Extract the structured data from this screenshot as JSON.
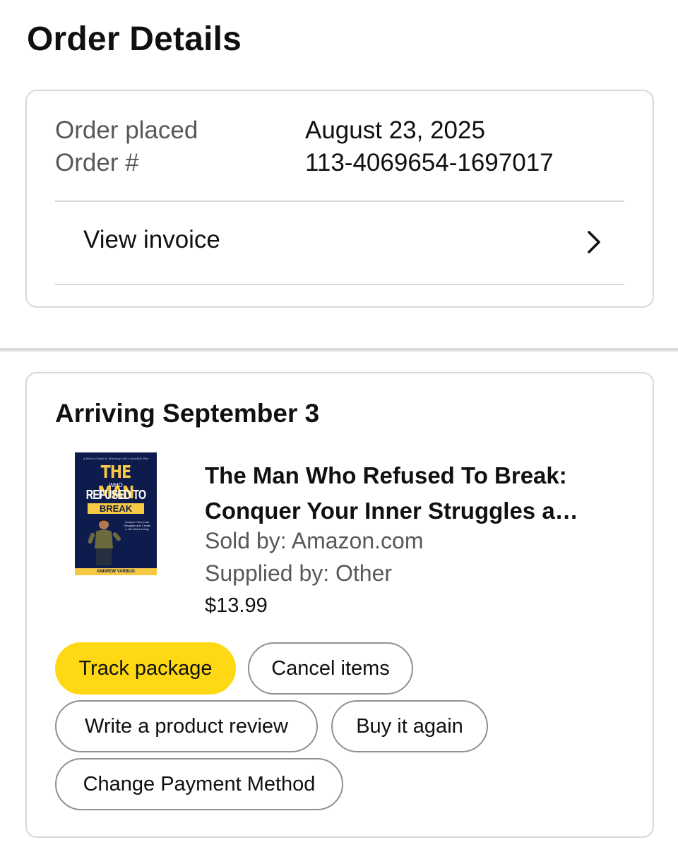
{
  "page": {
    "title": "Order Details"
  },
  "order_summary": {
    "placed_label": "Order placed",
    "placed_value": "August 23, 2025",
    "number_label": "Order #",
    "number_value": "113-4069654-1697017",
    "invoice_label": "View invoice",
    "invoice_icon": "chevron-right-icon"
  },
  "shipment": {
    "arrival": "Arriving September 3",
    "product": {
      "title_line1": "The Man Who Refused To Break:",
      "title_line2": "Conquer Your Inner Struggles a…",
      "sold_by": "Sold by: Amazon.com",
      "supplied_by": "Supplied by: Other",
      "price": "$13.99",
      "cover": {
        "tagline": "A Man's Guide to Winning Life's Invisible War",
        "title_the_man": "THE MAN",
        "title_who": "WHO",
        "title_refused": "REFUSED TO",
        "title_break": "BREAK",
        "subtitle": "Conquer Your Inner Struggles and Create a Life Worth Living",
        "author": "ANDREW YARBUG"
      }
    },
    "actions": {
      "track": "Track package",
      "cancel": "Cancel items",
      "review": "Write a product review",
      "buy_again": "Buy it again",
      "change_payment": "Change Payment Method"
    }
  },
  "colors": {
    "primary_button": "#ffd814",
    "border": "#d5d9d9",
    "secondary_text": "#565959",
    "cover_background": "#0e1c4d",
    "cover_accent": "#f6c844"
  }
}
